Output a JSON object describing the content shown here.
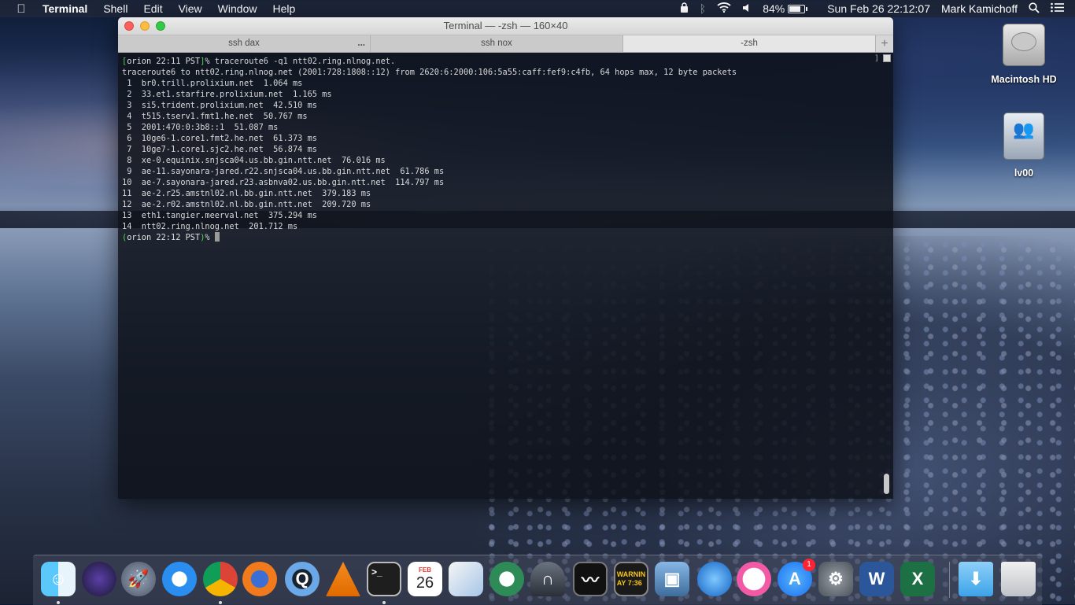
{
  "menubar": {
    "app": "Terminal",
    "menus": [
      "Shell",
      "Edit",
      "View",
      "Window",
      "Help"
    ],
    "battery_percent": "84%",
    "battery_level": 0.84,
    "datetime": "Sun Feb 26  22:12:07",
    "user": "Mark Kamichoff"
  },
  "desktop": {
    "icons": [
      {
        "label": "Macintosh HD",
        "icon": "hard-drive-icon"
      },
      {
        "label": "lv00",
        "icon": "usb-drive-icon"
      }
    ]
  },
  "terminal": {
    "title": "Terminal — -zsh — 160×40",
    "tabs": [
      {
        "label": "ssh dax",
        "overflow": "..."
      },
      {
        "label": "ssh nox"
      },
      {
        "label": "-zsh",
        "active": true
      }
    ],
    "add_tab": "+",
    "prompt1": {
      "open": "[",
      "text": "orion 22:11 PST",
      "close": "]",
      "symbol": "%",
      "command": " traceroute6 -q1 ntt02.ring.nlnog.net."
    },
    "header": "traceroute6 to ntt02.ring.nlnog.net (2001:728:1808::12) from 2620:6:2000:106:5a55:caff:fef9:c4fb, 64 hops max, 12 byte packets",
    "hops": [
      " 1  br0.trill.prolixium.net  1.064 ms",
      " 2  33.et1.starfire.prolixium.net  1.165 ms",
      " 3  si5.trident.prolixium.net  42.510 ms",
      " 4  t515.tserv1.fmt1.he.net  50.767 ms",
      " 5  2001:470:0:3b8::1  51.087 ms",
      " 6  10ge6-1.core1.fmt2.he.net  61.373 ms",
      " 7  10ge7-1.core1.sjc2.he.net  56.874 ms",
      " 8  xe-0.equinix.snjsca04.us.bb.gin.ntt.net  76.016 ms",
      " 9  ae-11.sayonara-jared.r22.snjsca04.us.bb.gin.ntt.net  61.786 ms",
      "10  ae-7.sayonara-jared.r23.asbnva02.us.bb.gin.ntt.net  114.797 ms",
      "11  ae-2.r25.amstnl02.nl.bb.gin.ntt.net  379.183 ms",
      "12  ae-2.r02.amstnl02.nl.bb.gin.ntt.net  209.720 ms",
      "13  eth1.tangier.meerval.net  375.294 ms",
      "14  ntt02.ring.nlnog.net  201.712 ms"
    ],
    "prompt2": {
      "open": "(",
      "text": "orion 22:12 PST",
      "close": ")",
      "symbol": "%"
    },
    "right_bracket": "]"
  },
  "dock": {
    "items": [
      {
        "name": "finder-icon",
        "running": true
      },
      {
        "name": "siri-icon",
        "running": false
      },
      {
        "name": "launchpad-icon",
        "running": false
      },
      {
        "name": "safari-icon",
        "running": false
      },
      {
        "name": "chrome-icon",
        "running": true
      },
      {
        "name": "firefox-icon",
        "running": false
      },
      {
        "name": "quicktime-icon",
        "running": false
      },
      {
        "name": "vlc-icon",
        "running": false
      },
      {
        "name": "terminal-icon",
        "running": true
      },
      {
        "name": "calendar-icon",
        "month": "FEB",
        "day": "26",
        "running": false
      },
      {
        "name": "preview-icon",
        "running": false
      },
      {
        "name": "network-icon",
        "running": false
      },
      {
        "name": "vpn-icon",
        "running": false
      },
      {
        "name": "activity-monitor-icon",
        "running": false
      },
      {
        "name": "console-icon",
        "text": "WARNIN\nAY 7:36",
        "running": false
      },
      {
        "name": "iphoto-icon",
        "running": false
      },
      {
        "name": "cyberduck-icon",
        "running": false
      },
      {
        "name": "itunes-icon",
        "running": false
      },
      {
        "name": "app-store-icon",
        "badge": "1",
        "running": false
      },
      {
        "name": "system-preferences-icon",
        "running": false
      },
      {
        "name": "word-icon",
        "running": false
      },
      {
        "name": "excel-icon",
        "running": false
      },
      {
        "name": "downloads-folder-icon",
        "running": false
      },
      {
        "name": "trash-icon",
        "running": false
      }
    ]
  }
}
